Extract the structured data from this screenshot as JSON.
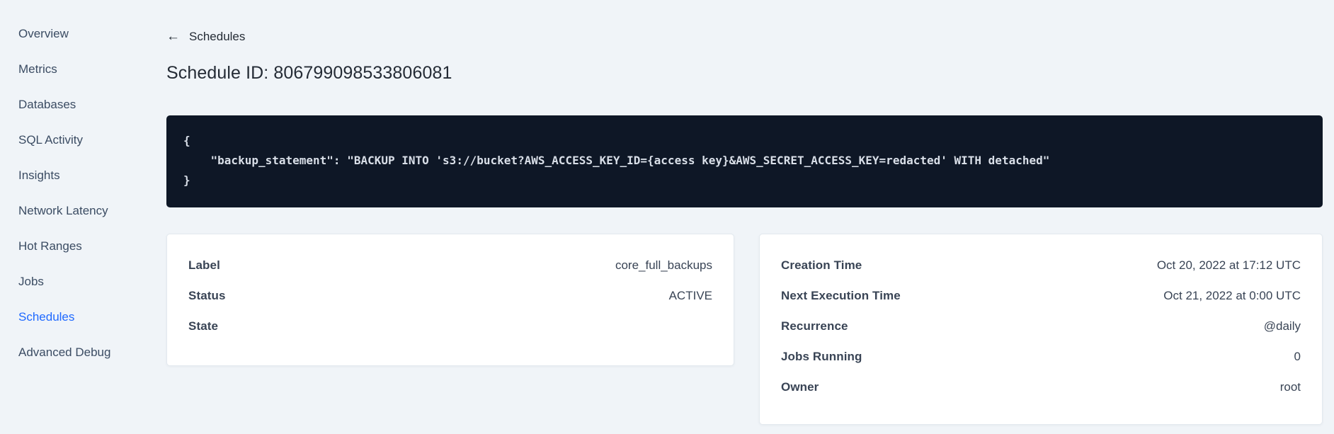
{
  "sidebar": {
    "items": [
      {
        "label": "Overview",
        "active": false
      },
      {
        "label": "Metrics",
        "active": false
      },
      {
        "label": "Databases",
        "active": false
      },
      {
        "label": "SQL Activity",
        "active": false
      },
      {
        "label": "Insights",
        "active": false
      },
      {
        "label": "Network Latency",
        "active": false
      },
      {
        "label": "Hot Ranges",
        "active": false
      },
      {
        "label": "Jobs",
        "active": false
      },
      {
        "label": "Schedules",
        "active": true
      },
      {
        "label": "Advanced Debug",
        "active": false
      }
    ]
  },
  "header": {
    "back_arrow_icon": "←",
    "back_label": "Schedules",
    "title": "Schedule ID: 806799098533806081"
  },
  "code_block": {
    "content": "{\n    \"backup_statement\": \"BACKUP INTO 's3://bucket?AWS_ACCESS_KEY_ID={access key}&AWS_SECRET_ACCESS_KEY=redacted' WITH detached\"\n}"
  },
  "details_card": {
    "rows": [
      {
        "label": "Label",
        "value": "core_full_backups"
      },
      {
        "label": "Status",
        "value": "ACTIVE"
      },
      {
        "label": "State",
        "value": ""
      }
    ]
  },
  "schedule_card": {
    "rows": [
      {
        "label": "Creation Time",
        "value": "Oct 20, 2022 at 17:12 UTC"
      },
      {
        "label": "Next Execution Time",
        "value": "Oct 21, 2022 at 0:00 UTC"
      },
      {
        "label": "Recurrence",
        "value": "@daily"
      },
      {
        "label": "Jobs Running",
        "value": "0"
      },
      {
        "label": "Owner",
        "value": "root"
      }
    ]
  },
  "colors": {
    "page_bg": "#f0f4f8",
    "accent_blue": "#1f69ff",
    "code_bg": "#0e1726",
    "text_dark": "#242b35"
  }
}
